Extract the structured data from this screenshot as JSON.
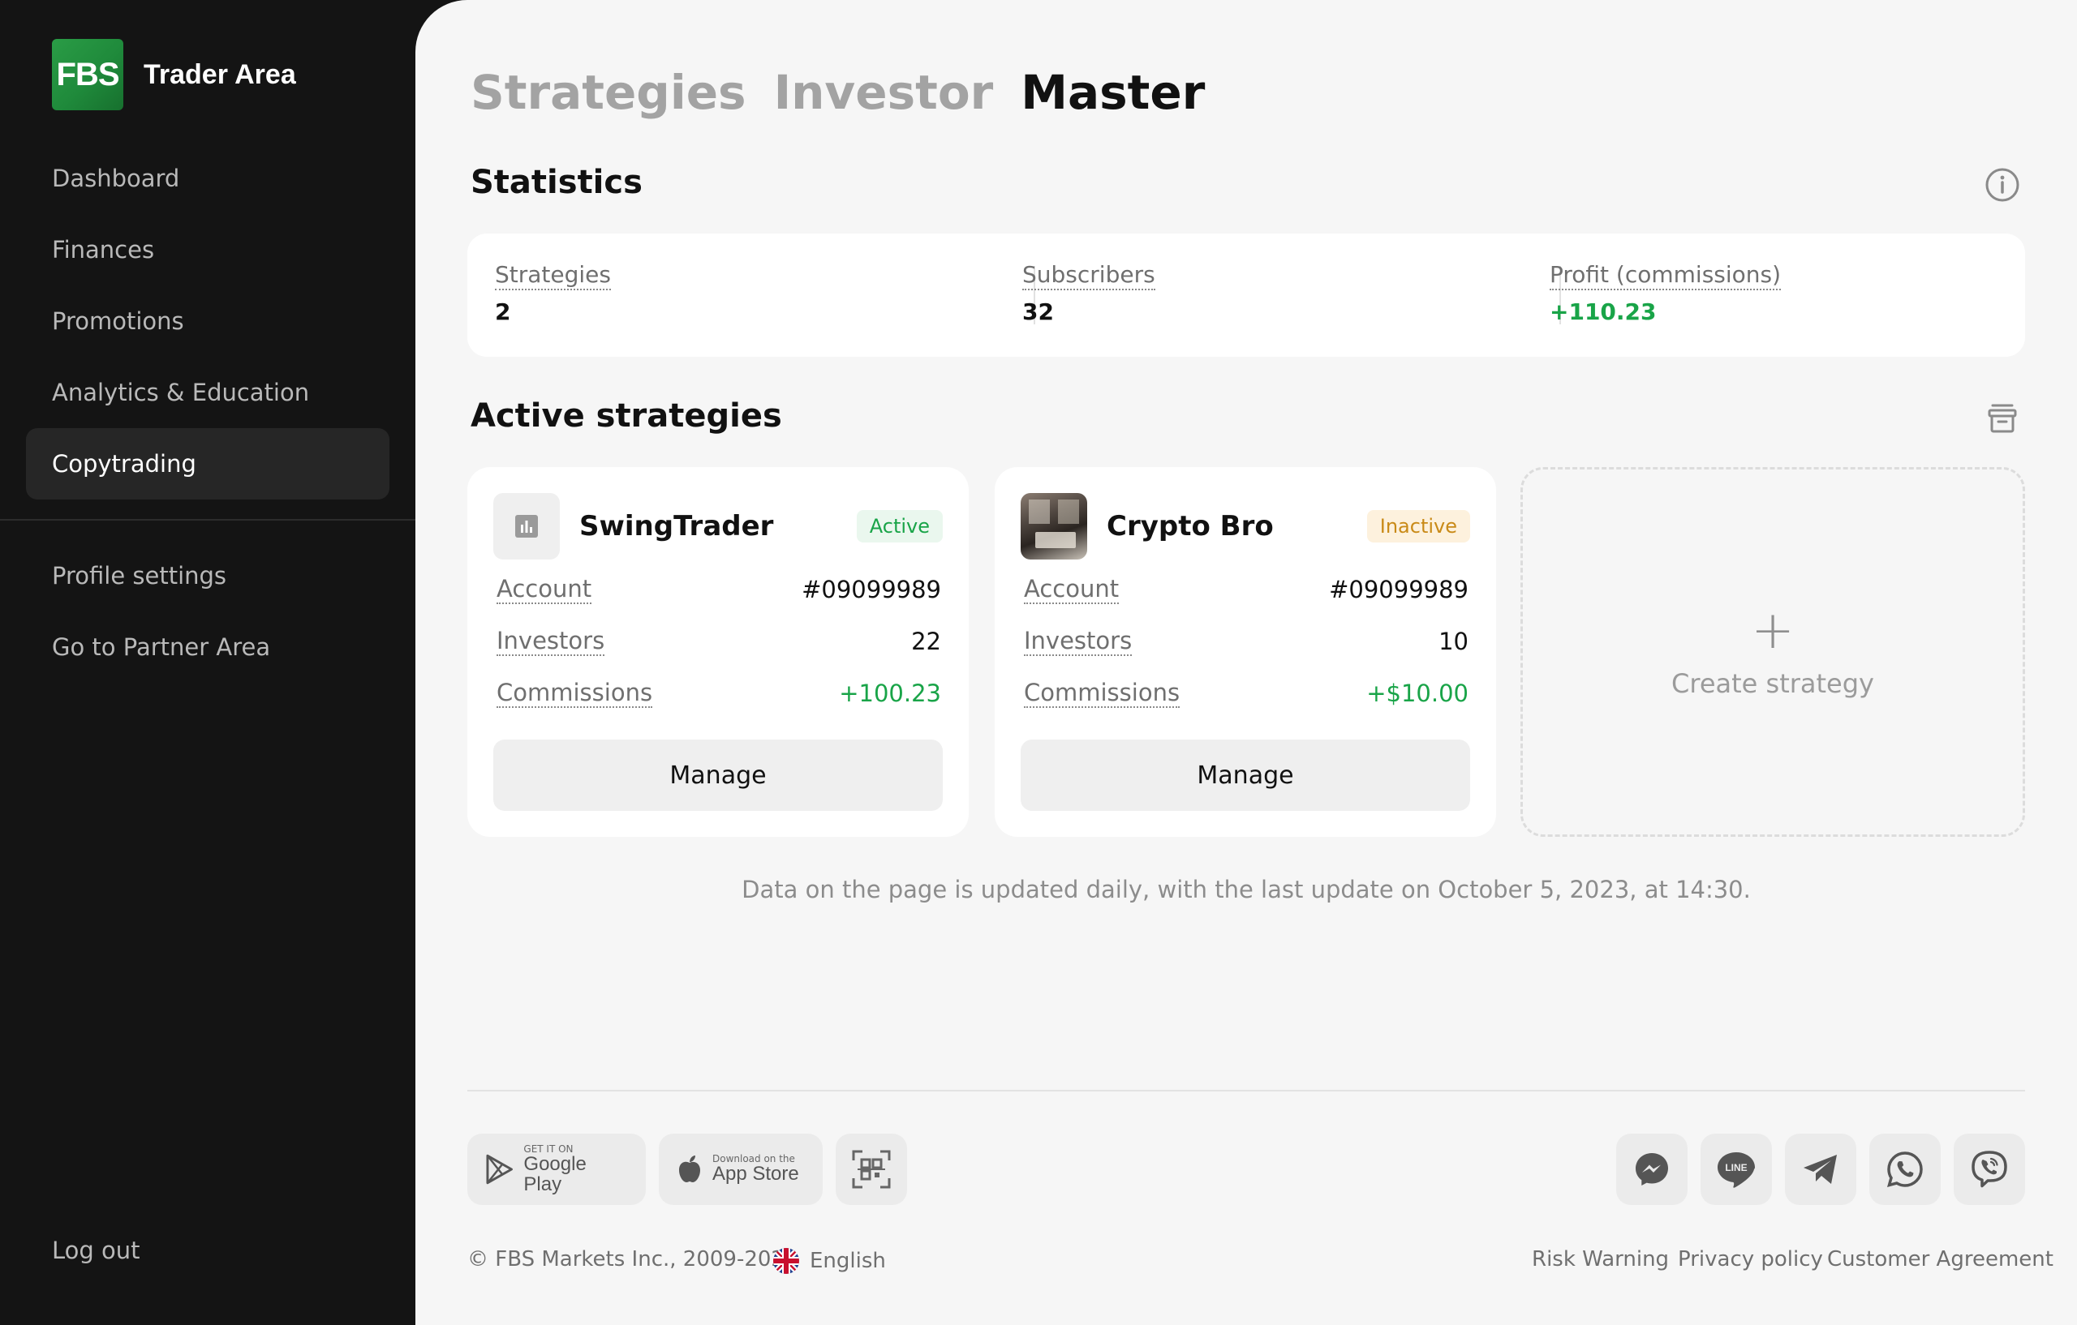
{
  "app": {
    "logo": "FBS",
    "title": "Trader Area"
  },
  "sidebar": {
    "items": [
      {
        "label": "Dashboard"
      },
      {
        "label": "Finances"
      },
      {
        "label": "Promotions"
      },
      {
        "label": "Analytics & Education"
      },
      {
        "label": "Copytrading",
        "active": true
      }
    ],
    "secondary": [
      {
        "label": "Profile settings"
      },
      {
        "label": "Go to Partner Area"
      }
    ],
    "logout": "Log out"
  },
  "tabs": [
    {
      "label": "Strategies"
    },
    {
      "label": "Investor"
    },
    {
      "label": "Master",
      "active": true
    }
  ],
  "statistics": {
    "title": "Statistics",
    "items": [
      {
        "label": "Strategies",
        "value": "2"
      },
      {
        "label": "Subscribers",
        "value": "32"
      },
      {
        "label": "Profit (commissions)",
        "value": "+110.23"
      }
    ]
  },
  "active_strategies": {
    "title": "Active strategies",
    "cards": [
      {
        "name": "SwingTrader",
        "status": "Active",
        "account_label": "Account",
        "account": "#09099989",
        "investors_label": "Investors",
        "investors": "22",
        "commissions_label": "Commissions",
        "commissions": "+100.23",
        "button": "Manage"
      },
      {
        "name": "Crypto Bro",
        "status": "Inactive",
        "account_label": "Account",
        "account": "#09099989",
        "investors_label": "Investors",
        "investors": "10",
        "commissions_label": "Commissions",
        "commissions": "+$10.00",
        "button": "Manage"
      }
    ],
    "create_label": "Create strategy",
    "create_icon": "+"
  },
  "update_note": "Data on the page is updated daily, with the last update on October 5, 2023, at 14:30.",
  "footer": {
    "google_small": "GET IT ON",
    "google_big": "Google Play",
    "apple_small": "Download on the",
    "apple_big": "App Store",
    "copyright": "© FBS Markets Inc., 2009-2024",
    "language": "English",
    "links": [
      "Risk Warning",
      "Privacy policy",
      "Customer Agreement"
    ]
  },
  "colors": {
    "accent_green": "#19a448",
    "brand_green": "#1f8a3b",
    "inactive": "#c98a17",
    "sidebar_bg": "#141414",
    "main_bg": "#f6f6f6"
  }
}
